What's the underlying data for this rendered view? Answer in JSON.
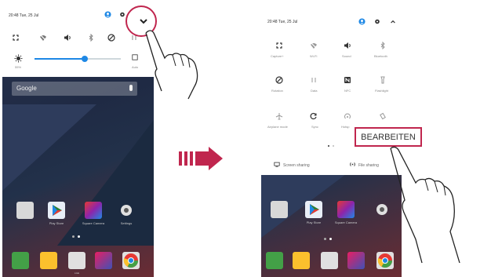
{
  "left_screen": {
    "status_time": "20:48 Tue, 25 Jul",
    "brightness_percent": "55%",
    "brightness_auto": "Auto",
    "search_placeholder": "Google",
    "brightness_level": 0.58
  },
  "right_screen": {
    "status_time": "20:48 Tue, 25 Jul",
    "quick_settings": [
      {
        "label": "Capture+",
        "icon": "capture-plus-icon"
      },
      {
        "label": "Wi-Fi",
        "icon": "wifi-off-icon"
      },
      {
        "label": "Sound",
        "icon": "sound-icon"
      },
      {
        "label": "Bluetooth",
        "icon": "bluetooth-off-icon"
      },
      {
        "label": "Rotation",
        "icon": "rotation-icon"
      },
      {
        "label": "Data",
        "icon": "data-off-icon"
      },
      {
        "label": "NFC",
        "icon": "nfc-icon"
      },
      {
        "label": "Flashlight",
        "icon": "flashlight-icon"
      },
      {
        "label": "Airplane mode",
        "icon": "airplane-icon"
      },
      {
        "label": "Sync",
        "icon": "sync-icon"
      },
      {
        "label": "Hotsp",
        "icon": "hotspot-icon"
      },
      {
        "label": "",
        "icon": "vibrate-icon"
      }
    ],
    "screen_sharing": "Screen sharing",
    "file_sharing": "File sharing"
  },
  "home": {
    "apps": [
      "Play Store",
      "Square Camera",
      "Settings"
    ],
    "dock_label": "LGE"
  },
  "callout": {
    "edit_label": "BEARBEITEN"
  },
  "colors": {
    "accent": "#c0264e",
    "highlight_blue": "#1e88e5"
  }
}
